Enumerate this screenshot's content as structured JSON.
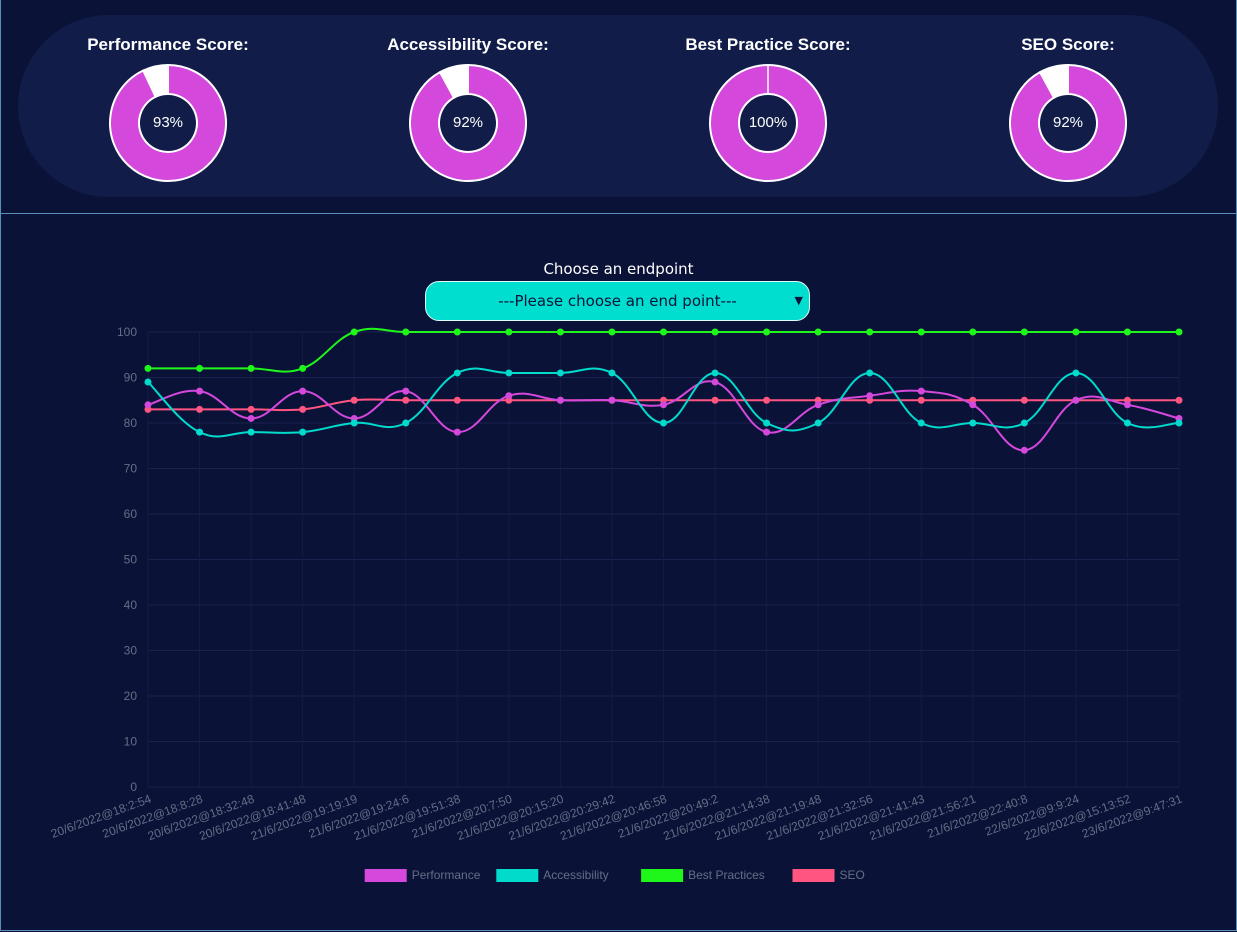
{
  "scores": [
    {
      "title": "Performance Score:",
      "value": 93,
      "label": "93%"
    },
    {
      "title": "Accessibility Score:",
      "value": 92,
      "label": "92%"
    },
    {
      "title": "Best Practice Score:",
      "value": 100,
      "label": "100%"
    },
    {
      "title": "SEO Score:",
      "value": 92,
      "label": "92%"
    }
  ],
  "colors": {
    "performance": "#d448dc",
    "accessibility": "#00dbcc",
    "best_practices": "#1ff71b",
    "seo": "#ff5580",
    "donut_fill": "#d448dc",
    "donut_rest": "#ffffff",
    "tick_text": "#666d85"
  },
  "endpoint": {
    "label": "Choose an endpoint",
    "selected": "---Please choose an end point---",
    "icon": "chevron-down-icon"
  },
  "chart_data": {
    "type": "line",
    "categories": [
      "20/6/2022@18:2:54",
      "20/6/2022@18:8:28",
      "20/6/2022@18:32:48",
      "20/6/2022@18:41:48",
      "21/6/2022@19:19:19",
      "21/6/2022@19:24:6",
      "21/6/2022@19:51:38",
      "21/6/2022@20:7:50",
      "21/6/2022@20:15:20",
      "21/6/2022@20:29:42",
      "21/6/2022@20:46:58",
      "21/6/2022@20:49:2",
      "21/6/2022@21:14:38",
      "21/6/2022@21:19:48",
      "21/6/2022@21:32:56",
      "21/6/2022@21:41:43",
      "21/6/2022@21:56:21",
      "21/6/2022@22:40:8",
      "22/6/2022@9:9:24",
      "22/6/2022@15:13:52",
      "23/6/2022@9:47:31"
    ],
    "series": [
      {
        "name": "Performance",
        "values": [
          84,
          87,
          81,
          87,
          81,
          87,
          78,
          86,
          85,
          85,
          84,
          89,
          78,
          84,
          86,
          87,
          84,
          74,
          85,
          84,
          81
        ]
      },
      {
        "name": "Accessibility",
        "values": [
          89,
          78,
          78,
          78,
          80,
          80,
          91,
          91,
          91,
          91,
          80,
          91,
          80,
          80,
          91,
          80,
          80,
          80,
          91,
          80,
          80
        ]
      },
      {
        "name": "Best Practices",
        "values": [
          92,
          92,
          92,
          92,
          100,
          100,
          100,
          100,
          100,
          100,
          100,
          100,
          100,
          100,
          100,
          100,
          100,
          100,
          100,
          100,
          100
        ]
      },
      {
        "name": "SEO",
        "values": [
          83,
          83,
          83,
          83,
          85,
          85,
          85,
          85,
          85,
          85,
          85,
          85,
          85,
          85,
          85,
          85,
          85,
          85,
          85,
          85,
          85
        ]
      }
    ],
    "yticks": [
      "0",
      "10",
      "20",
      "30",
      "40",
      "50",
      "60",
      "70",
      "80",
      "90",
      "100"
    ],
    "ylim": [
      0,
      100
    ],
    "grid": true,
    "legend_position": "bottom"
  }
}
